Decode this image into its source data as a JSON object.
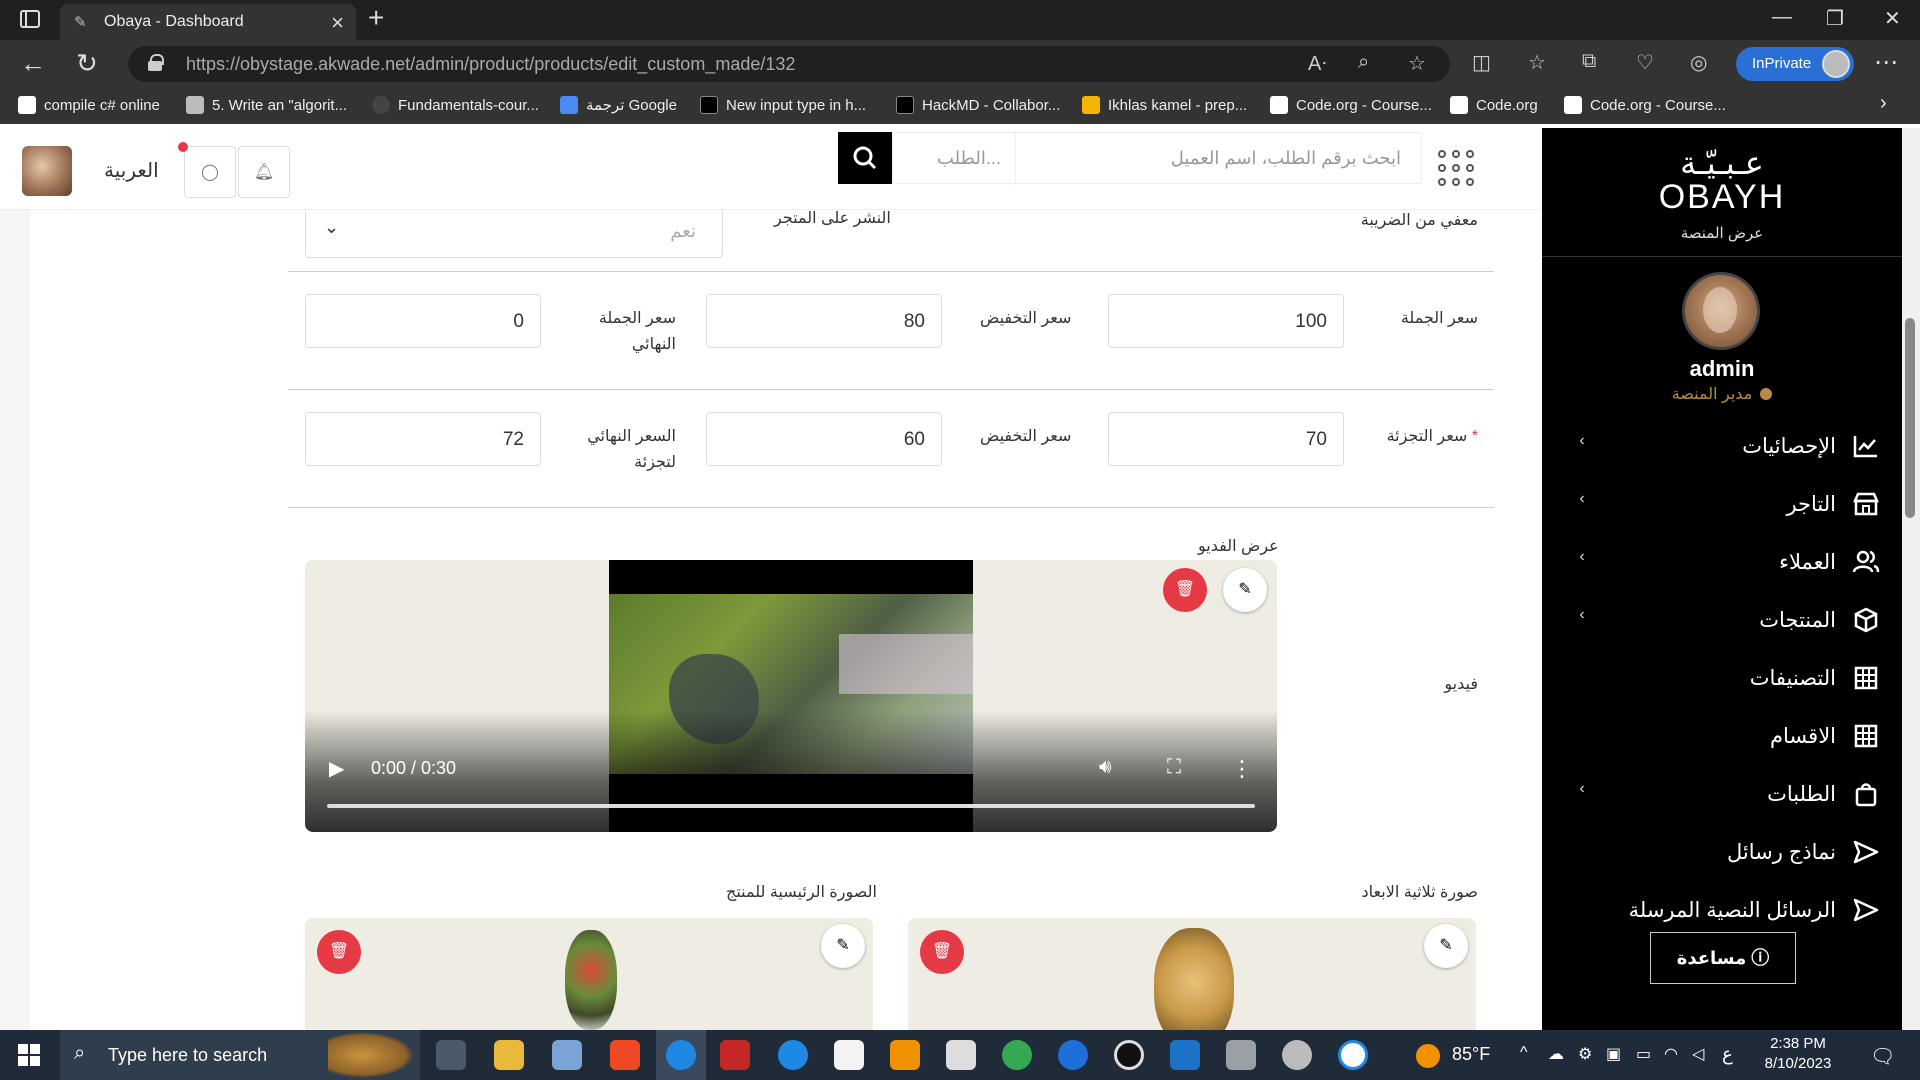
{
  "browser": {
    "tab_title": "Obaya - Dashboard",
    "url_host": "https://obystage.akwade.net",
    "url_path": "/admin/product/products/edit_custom_made/132",
    "inprivate_label": "InPrivate",
    "bookmarks": [
      {
        "label": "compile c# online",
        "color": "#ffffff"
      },
      {
        "label": "5. Write an \"algorit...",
        "color": "#bbbbbb"
      },
      {
        "label": "Fundamentals-cour...",
        "color": "#444444"
      },
      {
        "label": "ترجمة Google",
        "color": "#4a8af4"
      },
      {
        "label": "New input type in h...",
        "color": "#000000"
      },
      {
        "label": "HackMD - Collabor...",
        "color": "#000000"
      },
      {
        "label": "Ikhlas kamel - prep...",
        "color": "#f4b400"
      },
      {
        "label": "Code.org - Course...",
        "color": "#ffffff"
      },
      {
        "label": "Code.org",
        "color": "#ffffff"
      },
      {
        "label": "Code.org - Course...",
        "color": "#ffffff"
      }
    ]
  },
  "header": {
    "language": "العربية",
    "search_placeholder_main": "ابحث برقم الطلب، اسم العميل",
    "search_placeholder_side": "الطلب..."
  },
  "sidebar": {
    "logo_ar": "عـبـيّـة",
    "logo_en": "OBAYH",
    "subtitle": "عرض المنصة",
    "user_name": "admin",
    "user_role": "مدير المنصة",
    "items": [
      {
        "label": "الإحصائيات",
        "icon": "chart-line-icon",
        "has_chevron": true
      },
      {
        "label": "التاجر",
        "icon": "store-icon",
        "has_chevron": true
      },
      {
        "label": "العملاء",
        "icon": "users-icon",
        "has_chevron": true
      },
      {
        "label": "المنتجات",
        "icon": "box-icon",
        "has_chevron": true
      },
      {
        "label": "التصنيفات",
        "icon": "grid-icon",
        "has_chevron": false
      },
      {
        "label": "الاقسام",
        "icon": "grid-icon",
        "has_chevron": false
      },
      {
        "label": "الطلبات",
        "icon": "bag-icon",
        "has_chevron": true
      },
      {
        "label": "نماذج رسائل",
        "icon": "send-icon",
        "has_chevron": false
      },
      {
        "label": "الرسائل النصية المرسلة",
        "icon": "send-icon",
        "has_chevron": false
      }
    ],
    "help_label": "مساعدة"
  },
  "form": {
    "tax_exempt_label": "معفي من الضريبة",
    "publish_label": "النشر على المتجر",
    "publish_value": "نعم",
    "wholesale_label": "سعر الجملة",
    "wholesale_value": "100",
    "discount_label": "سعر التخفيض",
    "wholesale_discount_value": "80",
    "wholesale_final_label": "سعر الجملة النهائي",
    "wholesale_final_value": "0",
    "retail_label": "سعر التجزئة",
    "retail_value": "70",
    "retail_discount_value": "60",
    "retail_final_label": "السعر النهائي لتجزئة",
    "retail_final_value": "72",
    "video_display_label": "عرض الفديو",
    "video_label": "فيديو",
    "video_time": "0:00 / 0:30",
    "main_image_label": "الصورة الرئيسية للمنتج",
    "image_3d_label": "صورة ثلاثية الابعاد"
  },
  "taskbar": {
    "search_placeholder": "Type here to search",
    "temperature": "85°F",
    "lang_indicator": "ع",
    "time": "2:38 PM",
    "date": "8/10/2023"
  },
  "colors": {
    "accent_red": "#e53946",
    "sidebar_bg": "#000000",
    "role_color": "#b88b4a",
    "inprivate_blue": "#2a6fd6"
  }
}
